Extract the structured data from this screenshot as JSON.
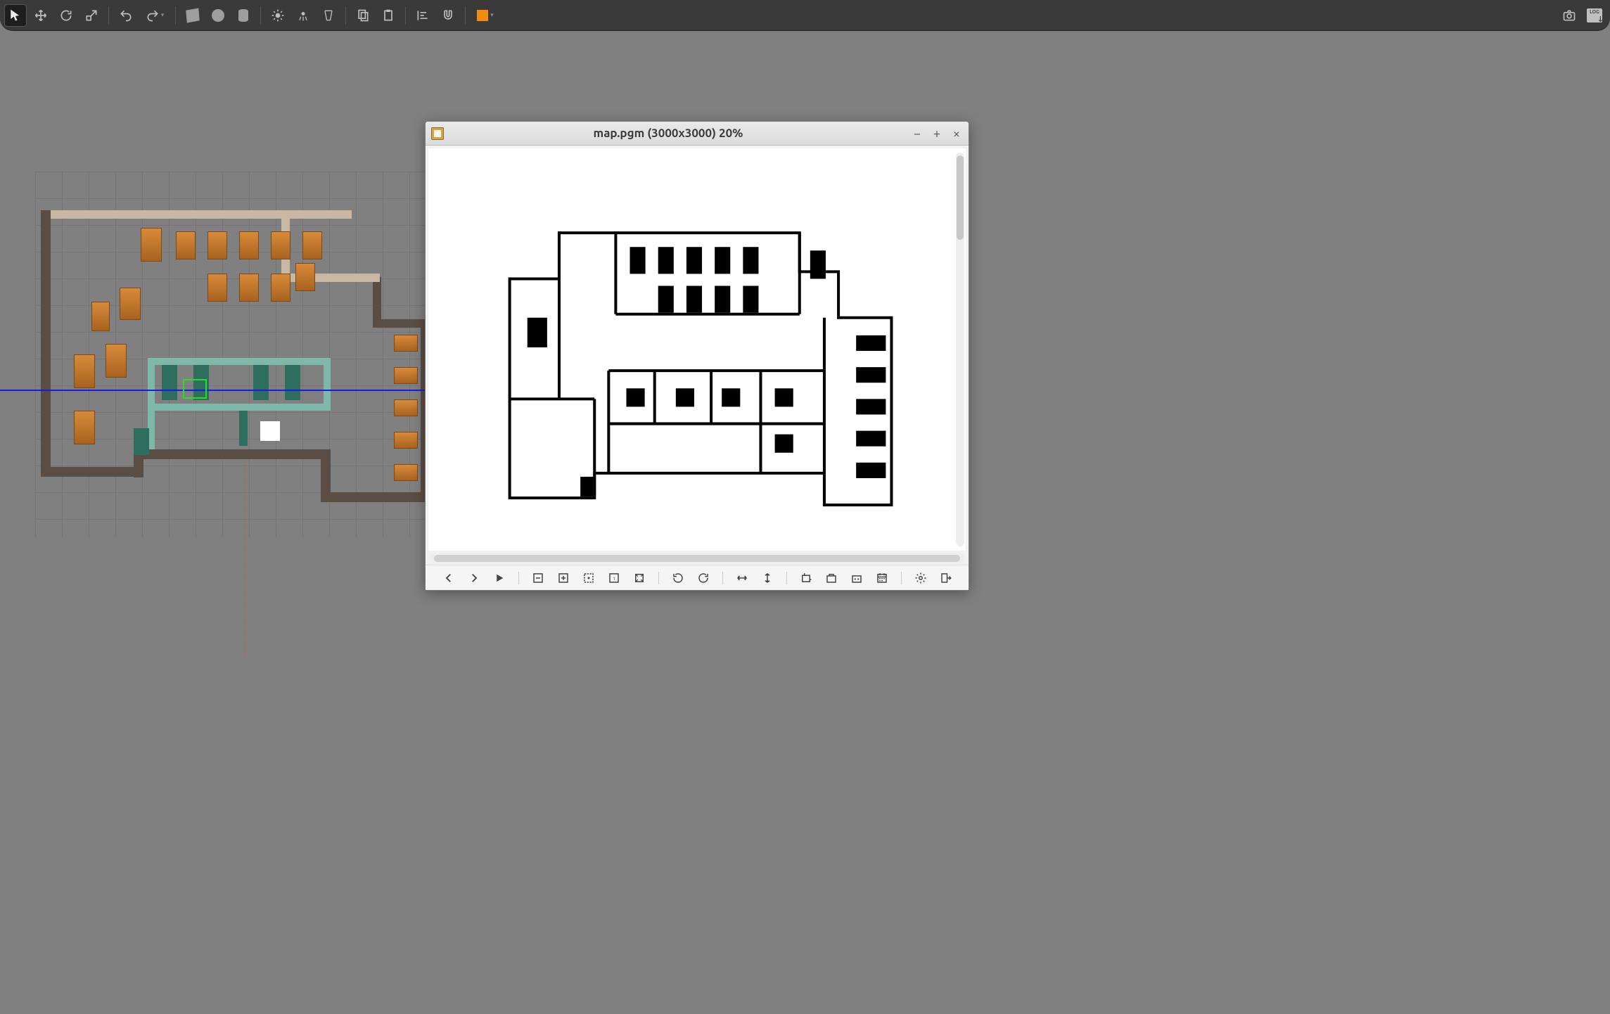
{
  "top_toolbar": {
    "groups": [
      {
        "items": [
          {
            "name": "select-tool",
            "icon": "cursor",
            "active": true
          },
          {
            "name": "translate-tool",
            "icon": "move"
          },
          {
            "name": "rotate-tool",
            "icon": "rotate"
          },
          {
            "name": "scale-tool",
            "icon": "scale"
          }
        ]
      },
      {
        "items": [
          {
            "name": "undo-button",
            "icon": "undo"
          },
          {
            "name": "redo-button",
            "icon": "redo",
            "has_dropdown": true
          }
        ]
      },
      {
        "items": [
          {
            "name": "insert-box-button",
            "icon": "box"
          },
          {
            "name": "insert-sphere-button",
            "icon": "sphere"
          },
          {
            "name": "insert-cylinder-button",
            "icon": "cylinder"
          }
        ]
      },
      {
        "items": [
          {
            "name": "insert-sun-light-button",
            "icon": "sun"
          },
          {
            "name": "insert-point-light-button",
            "icon": "pointlight"
          },
          {
            "name": "insert-spot-light-button",
            "icon": "spotlight"
          }
        ]
      },
      {
        "items": [
          {
            "name": "copy-button",
            "icon": "copy"
          },
          {
            "name": "paste-button",
            "icon": "paste"
          }
        ]
      },
      {
        "items": [
          {
            "name": "align-button",
            "icon": "align"
          },
          {
            "name": "snap-button",
            "icon": "magnet"
          }
        ]
      },
      {
        "items": [
          {
            "name": "view-angle-button",
            "icon": "orange-box",
            "has_dropdown": true
          }
        ]
      }
    ],
    "right_items": [
      {
        "name": "screenshot-button",
        "icon": "camera"
      },
      {
        "name": "log-button",
        "icon": "log",
        "label": "LOG"
      }
    ]
  },
  "image_viewer": {
    "title": "map.pgm (3000x3000) 20%",
    "toolbar": [
      {
        "name": "prev-button",
        "icon": "chev-left"
      },
      {
        "name": "next-button",
        "icon": "chev-right"
      },
      {
        "name": "play-button",
        "icon": "play"
      },
      {
        "sep": true
      },
      {
        "name": "zoom-out-button",
        "icon": "zoom-out"
      },
      {
        "name": "zoom-in-button",
        "icon": "zoom-in"
      },
      {
        "name": "zoom-fit-button",
        "icon": "zoom-fit"
      },
      {
        "name": "zoom-100-button",
        "icon": "zoom-100"
      },
      {
        "name": "zoom-fill-button",
        "icon": "zoom-fill"
      },
      {
        "sep": true
      },
      {
        "name": "rotate-ccw-button",
        "icon": "rot-ccw"
      },
      {
        "name": "rotate-cw-button",
        "icon": "rot-cw"
      },
      {
        "sep": true
      },
      {
        "name": "flip-horizontal-button",
        "icon": "flip-h"
      },
      {
        "name": "flip-vertical-button",
        "icon": "flip-v"
      },
      {
        "sep": true
      },
      {
        "name": "crop-button",
        "icon": "crop"
      },
      {
        "name": "resize-button",
        "icon": "resize"
      },
      {
        "name": "color-button",
        "icon": "color"
      },
      {
        "name": "date-button",
        "icon": "calendar"
      },
      {
        "sep": true
      },
      {
        "name": "settings-button",
        "icon": "gear"
      },
      {
        "name": "exit-button",
        "icon": "exit"
      }
    ]
  }
}
